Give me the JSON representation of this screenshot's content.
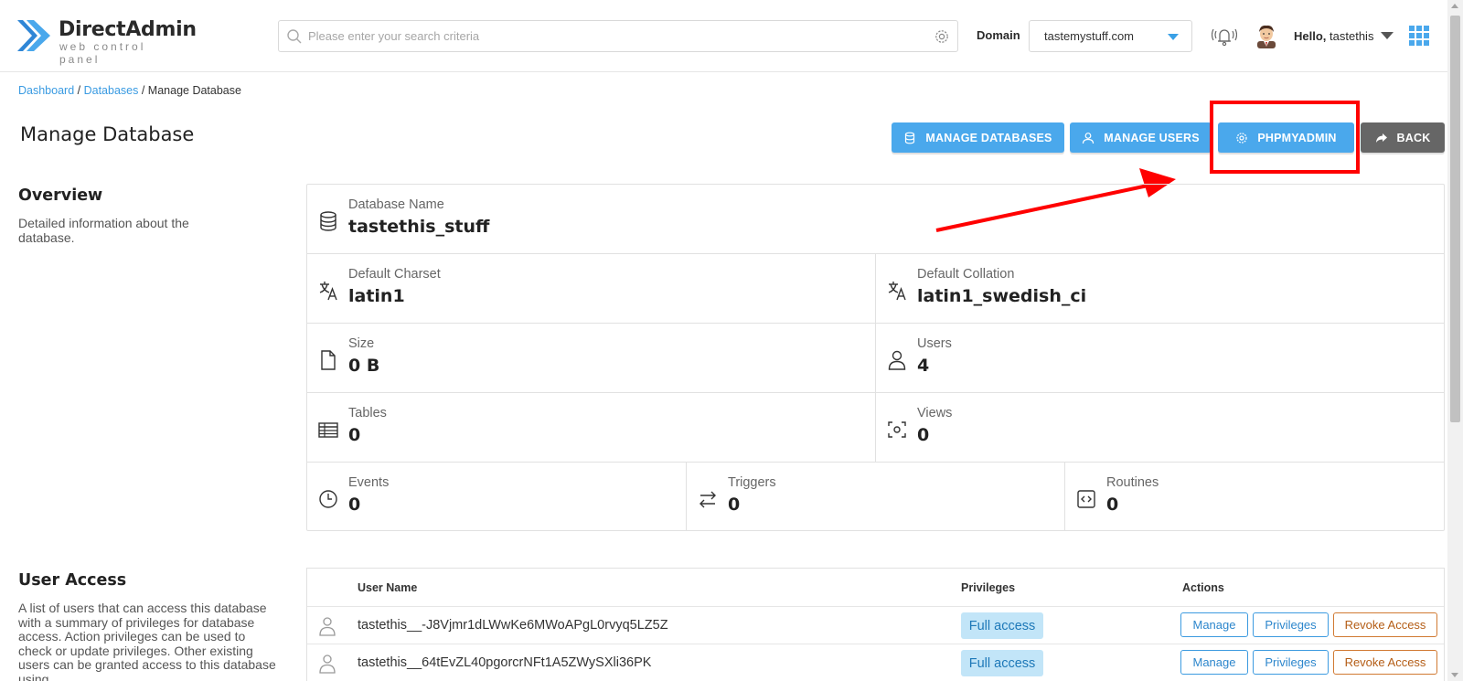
{
  "app": {
    "logo_title": "DirectAdmin",
    "logo_subtitle": "web control panel"
  },
  "header": {
    "search_placeholder": "Please enter your search criteria",
    "domain_label": "Domain",
    "domain_value": "tastemystuff.com",
    "hello_prefix": "Hello,",
    "username": "tastethis"
  },
  "breadcrumb": {
    "dashboard": "Dashboard",
    "databases": "Databases",
    "current": "Manage Database"
  },
  "page": {
    "title": "Manage Database"
  },
  "actions": {
    "manage_databases": "MANAGE DATABASES",
    "manage_users": "MANAGE USERS",
    "phpmyadmin": "PHPMYADMIN",
    "back": "BACK"
  },
  "overview": {
    "title": "Overview",
    "description": "Detailed information about the database.",
    "db_name_label": "Database Name",
    "db_name": "tastethis_stuff",
    "charset_label": "Default Charset",
    "charset": "latin1",
    "collation_label": "Default Collation",
    "collation": "latin1_swedish_ci",
    "size_label": "Size",
    "size": "0 B",
    "users_label": "Users",
    "users": "4",
    "tables_label": "Tables",
    "tables": "0",
    "views_label": "Views",
    "views": "0",
    "events_label": "Events",
    "events": "0",
    "triggers_label": "Triggers",
    "triggers": "0",
    "routines_label": "Routines",
    "routines": "0"
  },
  "user_access": {
    "title": "User Access",
    "description": "A list of users that can access this database with a summary of privileges for database access. Action privileges can be used to check or update privileges. Other existing users can be granted access to this database using",
    "columns": {
      "user_name": "User Name",
      "privileges": "Privileges",
      "actions": "Actions"
    },
    "rows": [
      {
        "name": "tastethis__-J8Vjmr1dLWwKe6MWoAPgL0rvyq5LZ5Z",
        "privilege": "Full access",
        "manage": "Manage",
        "privileges_btn": "Privileges",
        "revoke": "Revoke Access"
      },
      {
        "name": "tastethis__64tEvZL40pgorcrNFt1A5ZWySXli36PK",
        "privilege": "Full access",
        "manage": "Manage",
        "privileges_btn": "Privileges",
        "revoke": "Revoke Access"
      }
    ]
  },
  "colors": {
    "accent": "#4aa8ec",
    "link": "#3a9be2",
    "highlight": "#ff0000",
    "back_button": "#666666"
  }
}
